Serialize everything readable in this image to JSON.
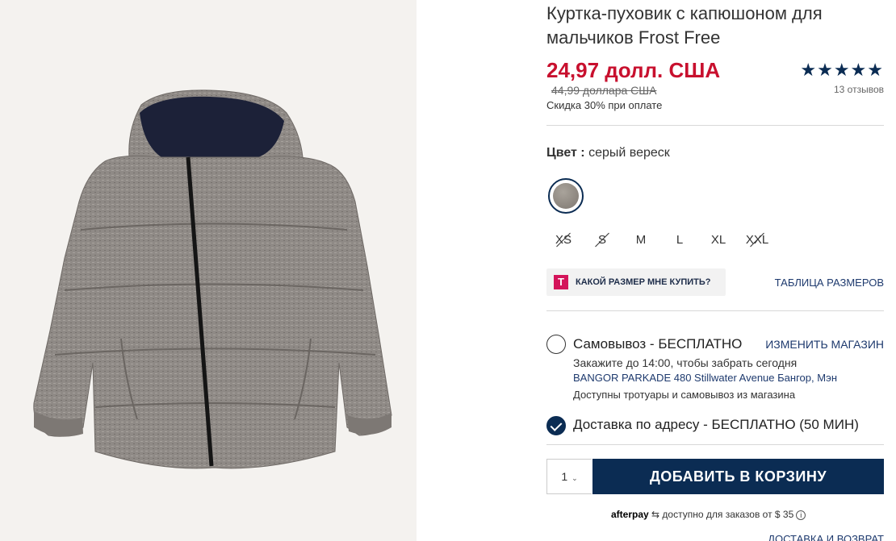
{
  "product": {
    "title": "Куртка-пуховик с капюшоном для мальчиков Frost Free",
    "price": "24,97 долл. США",
    "old_price": "44,99 доллара США",
    "discount_note": "Скидка 30% при оплате",
    "rating_stars": "★★★★★",
    "reviews": "13 отзывов"
  },
  "color": {
    "label": "Цвет",
    "separator": " : ",
    "value": "серый вереск",
    "swatch_color": "#8f8880"
  },
  "sizes": [
    {
      "label": "XS",
      "available": false
    },
    {
      "label": "S",
      "available": false
    },
    {
      "label": "M",
      "available": true
    },
    {
      "label": "L",
      "available": true
    },
    {
      "label": "XL",
      "available": true
    },
    {
      "label": "XXL",
      "available": false
    }
  ],
  "fit": {
    "icon_letter": "T",
    "label": "КАКОЙ РАЗМЕР МНЕ КУПИТЬ?",
    "size_chart": "ТАБЛИЦА РАЗМЕРОВ"
  },
  "pickup": {
    "label": "Самовывоз - БЕСПЛАТНО",
    "change_store": "ИЗМЕНИТЬ МАГАЗИН",
    "order_by": "Закажите до 14:00, чтобы забрать сегодня",
    "address": "BANGOR PARKADE 480 Stillwater Avenue  Бангор, Мэн",
    "availability": "Доступны тротуары и самовывоз из магазина",
    "checked": false
  },
  "shipping": {
    "label": "Доставка по адресу - БЕСПЛАТНО (50 МИН)",
    "checked": true
  },
  "cart": {
    "quantity": "1",
    "add_button": "ДОБАВИТЬ В КОРЗИНУ"
  },
  "afterpay": {
    "brand": "afterpay",
    "text": "доступно для заказов от $ 35"
  },
  "footer": {
    "returns": "ДОСТАВКА И ВОЗВРАТ"
  },
  "colors": {
    "sale_red": "#c8102e",
    "navy": "#0b2c53",
    "link_blue": "#1e3a6e",
    "image_bg": "#f4f2ef"
  }
}
